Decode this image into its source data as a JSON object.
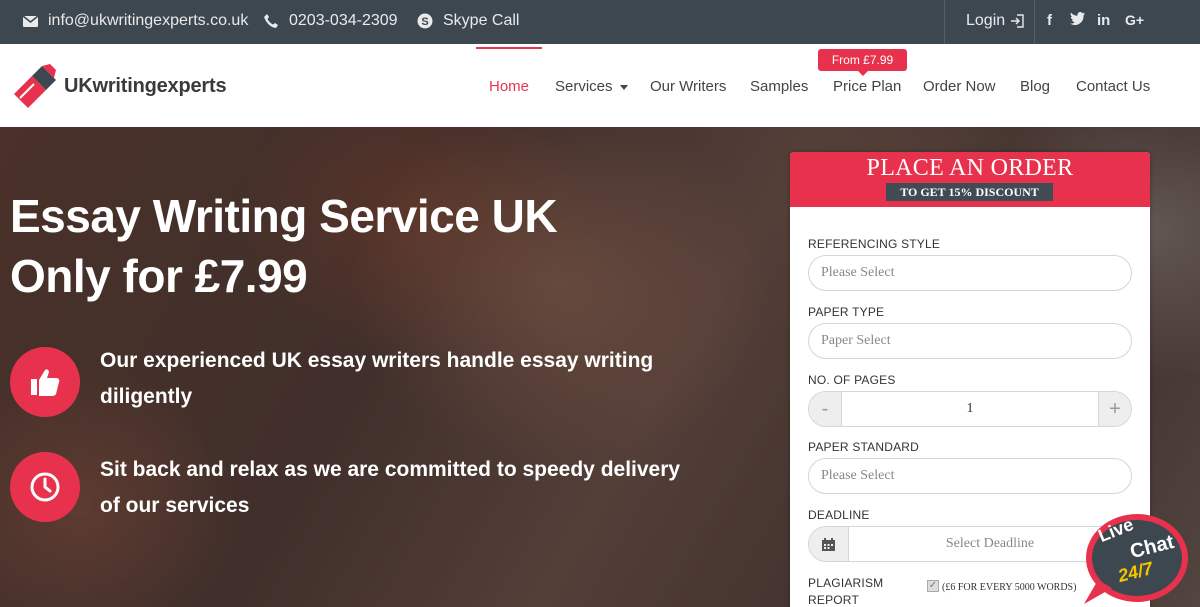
{
  "topbar": {
    "email": "info@ukwritingexperts.co.uk",
    "phone": "0203-034-2309",
    "skype": "Skype Call",
    "login": "Login",
    "social": [
      "f",
      "t",
      "in",
      "G+"
    ]
  },
  "brand": {
    "name": "UKwritingexperts"
  },
  "nav": {
    "items": [
      "Home",
      "Services",
      "Our Writers",
      "Samples",
      "Price Plan",
      "Order Now",
      "Blog",
      "Contact Us"
    ],
    "price_badge": "From £7.99"
  },
  "hero": {
    "title_line1": "Essay Writing Service UK",
    "title_line2": "Only for £7.99",
    "features": [
      {
        "icon": "thumbs-up-icon",
        "text_line1": "Our experienced UK essay writers handle essay writing",
        "text_line2": "diligently"
      },
      {
        "icon": "clock-icon",
        "text_line1": "Sit back and relax as we are committed to speedy delivery",
        "text_line2": "of our services"
      }
    ]
  },
  "order": {
    "title": "PLACE AN ORDER",
    "subtitle": "TO GET 15% DISCOUNT",
    "referencing_label": "REFERENCING STYLE",
    "referencing_placeholder": "Please Select",
    "paper_type_label": "PAPER TYPE",
    "paper_type_placeholder": "Paper Select",
    "pages_label": "NO. OF PAGES",
    "pages_value": "1",
    "minus": "-",
    "plus": "+",
    "standard_label": "PAPER STANDARD",
    "standard_placeholder": "Please Select",
    "deadline_label": "DEADLINE",
    "deadline_placeholder": "Select Deadline",
    "plagiarism_label_1": "PLAGIARISM",
    "plagiarism_label_2": "REPORT",
    "plagiarism_note": "(£6 FOR EVERY 5000 WORDS)"
  },
  "livechat": {
    "line1": "Live",
    "line2": "Chat",
    "line3": "24/7"
  },
  "colors": {
    "accent": "#e8324d",
    "topbar": "#3d474f"
  }
}
